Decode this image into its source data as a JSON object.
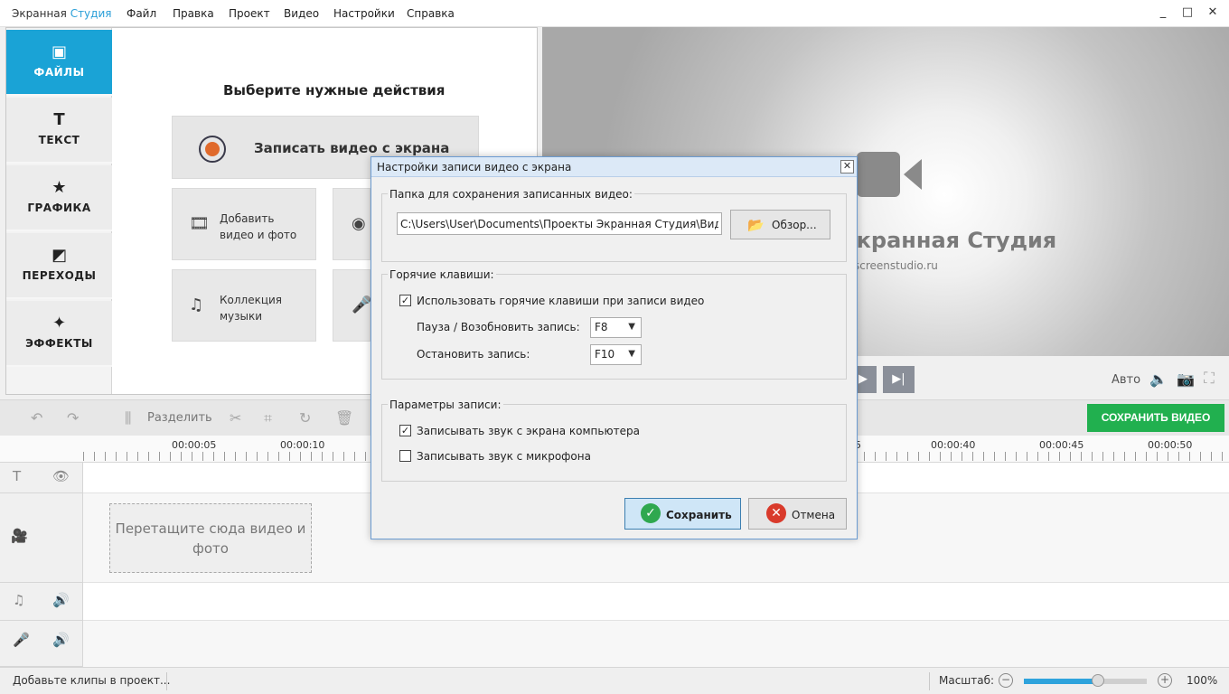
{
  "app": {
    "title_part1": "Экранная ",
    "title_part2": "Студия"
  },
  "menu": [
    "Файл",
    "Правка",
    "Проект",
    "Видео",
    "Настройки",
    "Справка"
  ],
  "window_controls": {
    "minimize": "_",
    "maximize": "□",
    "close": "✕"
  },
  "sidebar": {
    "items": [
      {
        "label": "ФАЙЛЫ",
        "icon": "image-icon",
        "glyph": "▣"
      },
      {
        "label": "ТЕКСТ",
        "icon": "text-icon",
        "glyph": "T"
      },
      {
        "label": "ГРАФИКА",
        "icon": "star-icon",
        "glyph": "★"
      },
      {
        "label": "ПЕРЕХОДЫ",
        "icon": "transitions-icon",
        "glyph": "◩"
      },
      {
        "label": "ЭФФЕКТЫ",
        "icon": "magic-wand-icon",
        "glyph": "✦"
      }
    ]
  },
  "content": {
    "title": "Выберите нужные действия",
    "record_label": "Записать видео с экрана",
    "add_media_label": "Добавить видео и фото",
    "music_label": "Коллекция музыки"
  },
  "preview": {
    "brand": "Экранная Студия",
    "url": "screenstudio.ru"
  },
  "player": {
    "auto_label": "Авто"
  },
  "toolbar": {
    "split_label": "Разделить",
    "save_video_label": "СОХРАНИТЬ ВИДЕО"
  },
  "ruler": {
    "labels": [
      "00:00:05",
      "00:00:10",
      "00:00:40",
      "00:00:45",
      "00:00:50"
    ],
    "partial_label": "5"
  },
  "timeline": {
    "dropzone_text": "Перетащите сюда видео и фото"
  },
  "status": {
    "message": "Добавьте клипы в проект...",
    "zoom_label": "Масштаб:",
    "zoom_value": "100%",
    "zoom_fraction": 0.6
  },
  "dialog": {
    "title": "Настройки записи видео с экрана",
    "close": "✕",
    "folder_group": "Папка для сохранения записанных видео:",
    "folder_path": "C:\\Users\\User\\Documents\\Проекты Экранная Студия\\Видео\\",
    "browse_label": "Обзор...",
    "hotkeys_group": "Горячие клавиши:",
    "use_hotkeys_label": "Использовать горячие клавиши при записи видео",
    "use_hotkeys_checked": true,
    "pause_label": "Пауза / Возобновить запись:",
    "pause_key": "F8",
    "stop_label": "Остановить запись:",
    "stop_key": "F10",
    "params_group": "Параметры записи:",
    "record_system_audio_label": "Записывать звук с экрана компьютера",
    "record_system_audio_checked": true,
    "record_mic_label": "Записывать звук с микрофона",
    "record_mic_checked": false,
    "save_label": "Сохранить",
    "cancel_label": "Отмена"
  },
  "colors": {
    "accent": "#1aa3d6",
    "save_green": "#21b04f",
    "title_accent": "#2a9fd8"
  }
}
